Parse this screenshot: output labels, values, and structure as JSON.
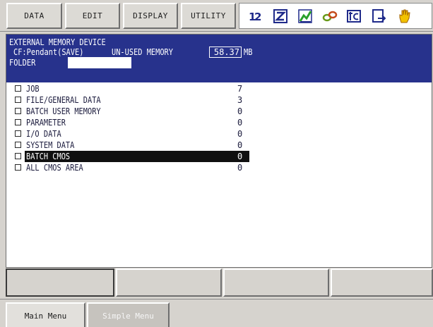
{
  "menu": {
    "data": "DATA",
    "edit": "EDIT",
    "display": "DISPLAY",
    "utility": "UTILITY"
  },
  "status_icons": [
    "number-12-icon",
    "z-icon",
    "graph-icon",
    "link-icon",
    "tc-icon",
    "save-arrow-icon",
    "hand-icon"
  ],
  "header": {
    "title": "EXTERNAL MEMORY DEVICE",
    "device": "CF:Pendant(SAVE)",
    "unused_label": "UN-USED MEMORY",
    "unused_value": "58.37",
    "unused_unit": "MB",
    "folder_label": "FOLDER",
    "folder_value": ""
  },
  "items": [
    {
      "name": "JOB",
      "count": "7"
    },
    {
      "name": "FILE/GENERAL DATA",
      "count": "3"
    },
    {
      "name": "BATCH USER MEMORY",
      "count": "0"
    },
    {
      "name": "PARAMETER",
      "count": "0"
    },
    {
      "name": "I/O DATA",
      "count": "0"
    },
    {
      "name": "SYSTEM DATA",
      "count": "0"
    },
    {
      "name": "BATCH CMOS",
      "count": "0"
    },
    {
      "name": "ALL CMOS AREA",
      "count": "0"
    }
  ],
  "selected_index": 6,
  "tabs": {
    "main": "Main Menu",
    "simple": "Simple Menu"
  },
  "colors": {
    "header_bg": "#27328c",
    "selected_bg": "#101010",
    "panel_bg": "#ffffff",
    "chrome_bg": "#d6d3ce"
  }
}
